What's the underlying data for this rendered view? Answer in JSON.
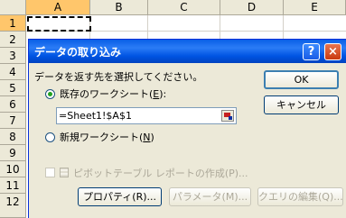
{
  "sheet": {
    "columns": [
      "A",
      "B",
      "C",
      "D",
      "E"
    ],
    "rows": [
      "1",
      "2",
      "3",
      "4",
      "5",
      "6",
      "7",
      "8",
      "9",
      "10",
      "11",
      "12"
    ]
  },
  "dialog": {
    "title": "データの取り込み",
    "help_glyph": "?",
    "close_glyph": "×",
    "prompt": "データを返す先を選択してください。",
    "option_existing": "既存のワークシート(",
    "option_existing_key": "E",
    "option_existing_end": "):",
    "reference_value": "=Sheet1!$A$1",
    "option_new": "新規ワークシート(",
    "option_new_key": "N",
    "option_new_end": ")",
    "pivot_label": "ピボットテーブル レポートの作成(P)...",
    "ok_label": "OK",
    "cancel_label": "キャンセル",
    "properties_label": "プロパティ(R)...",
    "parameters_label": "パラメータ(M)...",
    "edit_query_label": "クエリの編集(Q)..."
  }
}
